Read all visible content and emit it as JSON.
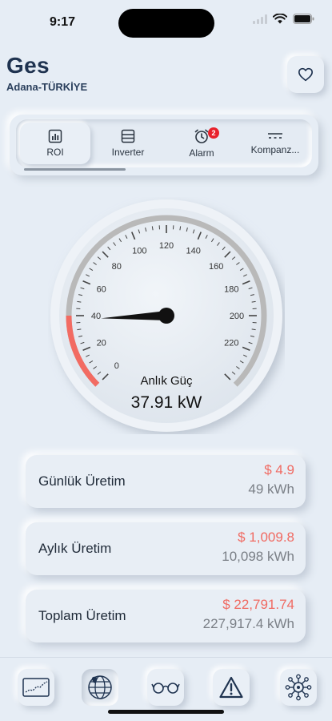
{
  "status": {
    "time": "9:17"
  },
  "header": {
    "title": "Ges",
    "location": "Adana-TÜRKİYE"
  },
  "tabs": [
    {
      "label": "ROI",
      "icon": "chart-icon"
    },
    {
      "label": "Inverter",
      "icon": "inverter-icon"
    },
    {
      "label": "Alarm",
      "icon": "alarm-clock-icon",
      "badge": "2"
    },
    {
      "label": "Kompanz...",
      "icon": "compensation-icon"
    }
  ],
  "gauge": {
    "label": "Anlık Güç",
    "value_text": "37.91 kW",
    "value": 37.91,
    "min": 0,
    "max": 240,
    "ticks": [
      "0",
      "20",
      "40",
      "60",
      "80",
      "100",
      "120",
      "140",
      "160",
      "180",
      "200",
      "220"
    ],
    "red_zone_max": 40,
    "colors": {
      "arc": "#b9b9b9",
      "red_zone": "#f26b62",
      "needle": "#111111"
    }
  },
  "cards": [
    {
      "title": "Günlük Üretim",
      "money": "$ 4.9",
      "energy": "49 kWh"
    },
    {
      "title": "Aylık Üretim",
      "money": "$ 1,009.8",
      "energy": "10,098 kWh"
    },
    {
      "title": "Toplam Üretim",
      "money": "$ 22,791.74",
      "energy": "227,917.4 kWh"
    }
  ],
  "bottom_nav": [
    {
      "icon": "line-chart-icon"
    },
    {
      "icon": "globe-icon",
      "active": true
    },
    {
      "icon": "glasses-icon"
    },
    {
      "icon": "warning-icon"
    },
    {
      "icon": "network-gear-icon"
    }
  ],
  "colors": {
    "accent": "#1f3350",
    "money": "#f06a62",
    "background": "#e6edf5"
  }
}
